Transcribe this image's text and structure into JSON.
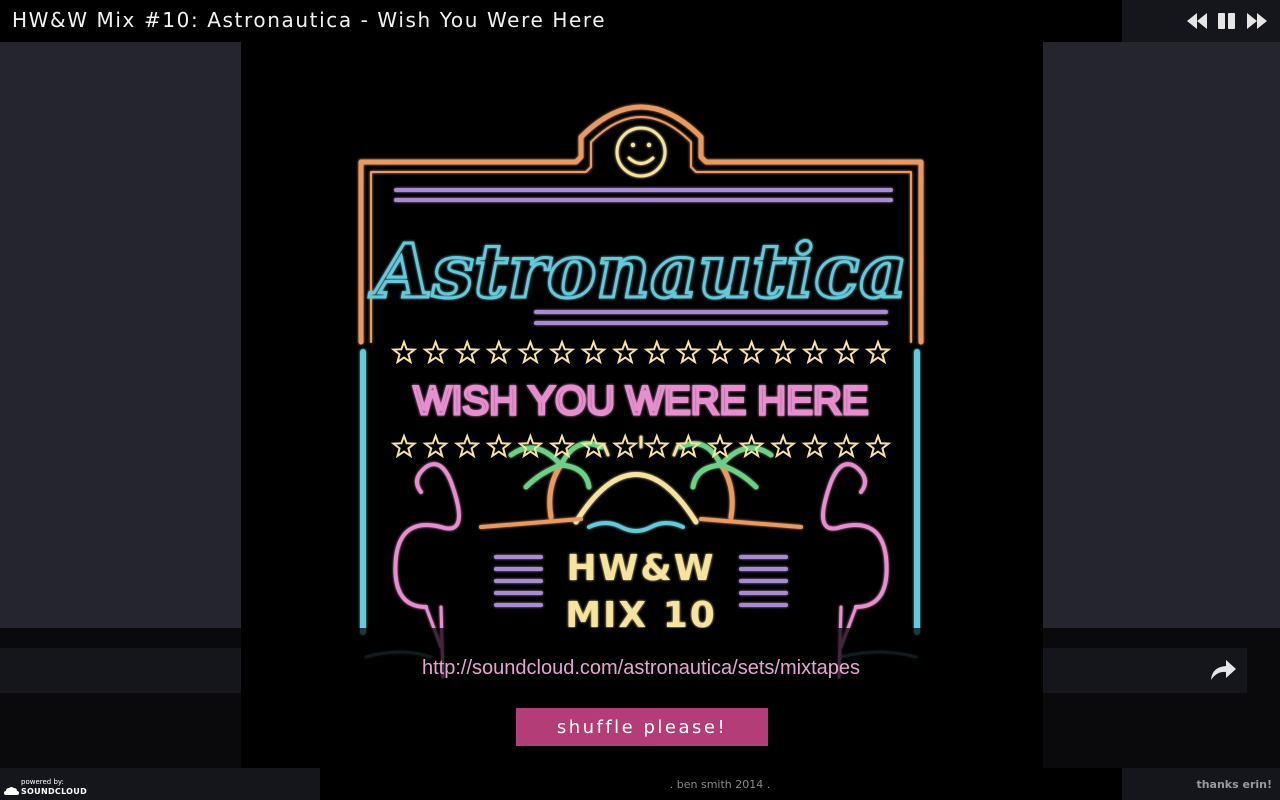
{
  "header": {
    "title": "HW&W Mix #10: Astronautica - Wish You Were Here",
    "controls": [
      "rewind-icon",
      "pause-icon",
      "fast-forward-icon"
    ]
  },
  "artwork": {
    "brand": "Astronautica",
    "subtitle": "WISH YOU WERE HERE",
    "mix_line1": "HW&W",
    "mix_line2": "MIX 10"
  },
  "link": {
    "url_text": "http://soundcloud.com/astronautica/sets/mixtapes"
  },
  "shuffle": {
    "label": "shuffle please!"
  },
  "share": {
    "icon": "share-arrow-icon"
  },
  "footer": {
    "powered_by": "powered by:",
    "soundcloud": "SOUNDCLOUD",
    "credit": ". ben smith 2014 .",
    "thanks": "thanks erin!"
  },
  "colors": {
    "accent": "#b23d77",
    "link": "#e3a6d2",
    "neon_orange": "#e89a63",
    "neon_cyan": "#66c8d8",
    "neon_pink": "#e58fcf",
    "neon_lavender": "#a98bd0",
    "neon_yellow": "#f6e3a0",
    "neon_green": "#6fcf87"
  }
}
